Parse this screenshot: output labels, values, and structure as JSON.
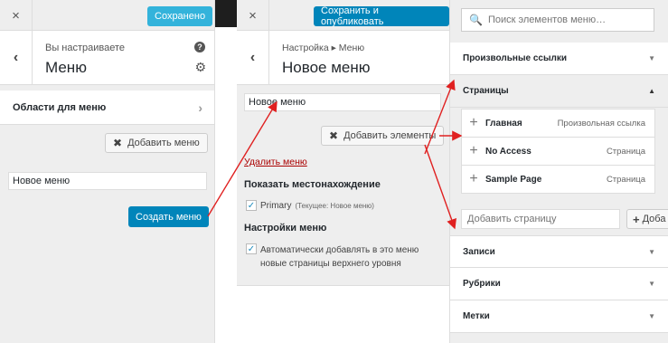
{
  "panel1": {
    "close_icon": "×",
    "saved_label": "Сохранено",
    "header_small": "Вы настраиваете",
    "header_big": "Меню",
    "section_label": "Области для меню",
    "add_menu_label": "Добавить меню",
    "menu_name_value": "Новое меню",
    "create_menu_label": "Создать меню"
  },
  "panel2": {
    "close_icon": "×",
    "publish_label": "Сохранить и опубликовать",
    "breadcrumb": "Настройка ▸ Меню",
    "header_big": "Новое меню",
    "menu_name_value": "Новое меню",
    "add_items_label": "Добавить элементы",
    "delete_menu_label": "Удалить меню",
    "locations_heading": "Показать местонахождение",
    "primary_label": "Primary",
    "primary_note": "(Текущее: Новое меню)",
    "settings_heading": "Настройки меню",
    "auto_add_line1": "Автоматически добавлять в это меню",
    "auto_add_line2": "новые страницы верхнего уровня",
    "check_mark": "✓"
  },
  "panel3": {
    "search_placeholder": "Поиск элементов меню…",
    "custom_links": "Произвольные ссылки",
    "pages": "Страницы",
    "items": [
      {
        "title": "Главная",
        "type": "Произвольная ссылка"
      },
      {
        "title": "No Access",
        "type": "Страница"
      },
      {
        "title": "Sample Page",
        "type": "Страница"
      }
    ],
    "add_page_placeholder": "Добавить страницу",
    "add_page_button": "Доба",
    "posts": "Записи",
    "categories": "Рубрики",
    "tags": "Метки",
    "plus_icon": "+"
  },
  "colors": {
    "primary_blue": "#0085ba",
    "saved_blue": "#33b3db",
    "arrow_red": "#e02020",
    "link_red": "#a00"
  }
}
